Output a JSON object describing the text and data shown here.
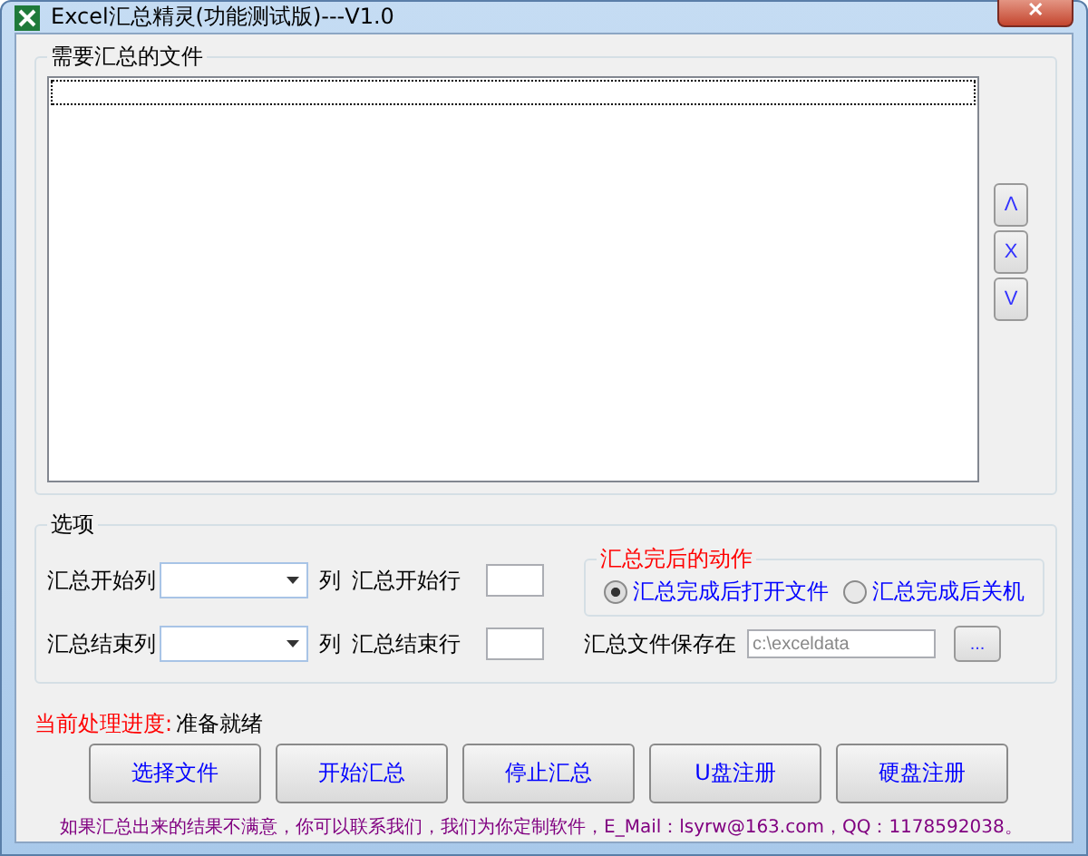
{
  "window": {
    "title": "Excel汇总精灵(功能测试版)---V1.0",
    "close": "✕"
  },
  "files_group": {
    "title": "需要汇总的文件",
    "side_buttons": [
      "Λ",
      "X",
      "V"
    ]
  },
  "options": {
    "title": "选项",
    "start_col": {
      "label": "汇总开始列",
      "unit": "列"
    },
    "start_row": {
      "label": "汇总开始行"
    },
    "end_col": {
      "label": "汇总结束列",
      "unit": "列"
    },
    "end_row": {
      "label": "汇总结束行"
    },
    "after_action": {
      "title": "汇总完后的动作",
      "choices": [
        {
          "label": "汇总完成后打开文件",
          "selected": true
        },
        {
          "label": "汇总完成后关机",
          "selected": false
        }
      ]
    },
    "save": {
      "label": "汇总文件保存在",
      "value": "c:\\exceldata",
      "browse": "..."
    }
  },
  "progress": {
    "label": "当前处理进度:",
    "value": "准备就绪"
  },
  "buttons": [
    "选择文件",
    "开始汇总",
    "停止汇总",
    "U盘注册",
    "硬盘注册"
  ],
  "footer": "如果汇总出来的结果不满意，你可以联系我们，我们为你定制软件，E_Mail：lsyrw@163.com，QQ：1178592038。"
}
